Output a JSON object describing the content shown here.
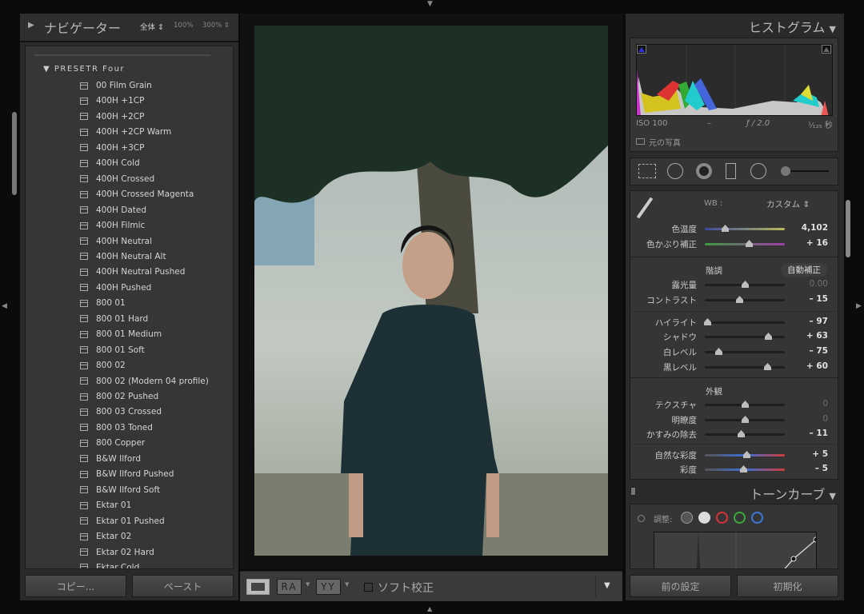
{
  "navigator": {
    "title": "ナビゲーター",
    "zoom_fit": "全体 ⇕",
    "zoom_100": "100%",
    "zoom_300": "300% ⇕"
  },
  "presets": {
    "group": "PRESETR Four",
    "items": [
      "00 Film Grain",
      "400H +1CP",
      "400H +2CP",
      "400H +2CP Warm",
      "400H +3CP",
      "400H Cold",
      "400H Crossed",
      "400H Crossed Magenta",
      "400H Dated",
      "400H Filmic",
      "400H Neutral",
      "400H Neutral Alt",
      "400H Neutral Pushed",
      "400H Pushed",
      "800 01",
      "800 01 Hard",
      "800 01 Medium",
      "800 01 Soft",
      "800 02",
      "800 02 (Modern 04 profile)",
      "800 02 Pushed",
      "800 03 Crossed",
      "800 03 Toned",
      "800 Copper",
      "B&W Ilford",
      "B&W Ilford Pushed",
      "B&W Ilford Soft",
      "Ektar 01",
      "Ektar 01 Pushed",
      "Ektar 02",
      "Ektar 02 Hard",
      "Ektar Cold"
    ]
  },
  "left_buttons": {
    "copy": "コピー...",
    "paste": "ペースト"
  },
  "toolbar": {
    "ra": "RA",
    "yy": "YY",
    "soft_proof": "ソフト校正",
    "soft_proof_checked": false
  },
  "histogram": {
    "title": "ヒストグラム",
    "iso": "ISO 100",
    "focal": "–",
    "aperture": "ƒ / 2.0",
    "shutter": "¹⁄₁₂₅ 秒",
    "original_photo": "元の写真"
  },
  "basic": {
    "wb_label": "WB :",
    "wb_value": "カスタム ⇕",
    "tone_label": "階調",
    "auto": "自動補正",
    "presence_label": "外観",
    "sliders": [
      {
        "label": "色温度",
        "value": "4,102",
        "level": 0.25,
        "track": "temp",
        "dim": false
      },
      {
        "label": "色かぶり補正",
        "value": "+ 16",
        "level": 0.55,
        "track": "tint",
        "dim": false
      },
      {
        "label": "露光量",
        "value": "0.00",
        "level": 0.5,
        "dim": true
      },
      {
        "label": "コントラスト",
        "value": "– 15",
        "level": 0.43,
        "dim": false
      },
      {
        "label": "ハイライト",
        "value": "– 97",
        "level": 0.03,
        "dim": false
      },
      {
        "label": "シャドウ",
        "value": "+ 63",
        "level": 0.79,
        "dim": false
      },
      {
        "label": "白レベル",
        "value": "– 75",
        "level": 0.17,
        "dim": false
      },
      {
        "label": "黒レベル",
        "value": "+ 60",
        "level": 0.78,
        "dim": false
      },
      {
        "label": "テクスチャ",
        "value": "0",
        "level": 0.5,
        "dim": true
      },
      {
        "label": "明瞭度",
        "value": "0",
        "level": 0.5,
        "dim": true
      },
      {
        "label": "かすみの除去",
        "value": "– 11",
        "level": 0.45,
        "dim": false
      },
      {
        "label": "自然な彩度",
        "value": "+ 5",
        "level": 0.52,
        "track": "sat",
        "dim": false
      },
      {
        "label": "彩度",
        "value": "– 5",
        "level": 0.48,
        "track": "sat",
        "dim": false
      }
    ]
  },
  "tone_curve": {
    "title": "トーンカーブ",
    "adjust": "調整:"
  },
  "right_buttons": {
    "previous": "前の設定",
    "reset": "初期化"
  },
  "colors": {
    "accent_red": "#d8333a",
    "accent_green": "#3aa83a",
    "accent_blue": "#3a78d8"
  }
}
